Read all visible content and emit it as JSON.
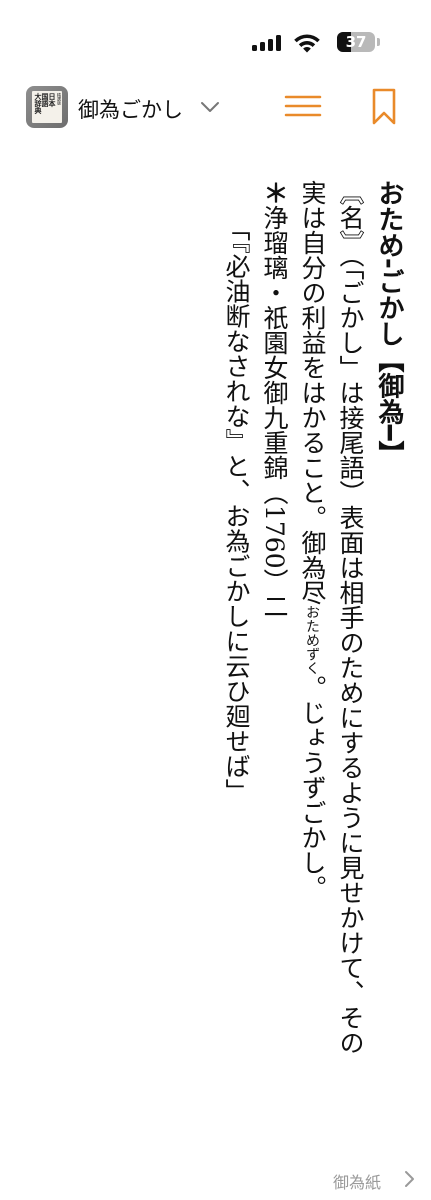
{
  "status_bar": {
    "battery": "37"
  },
  "header": {
    "app_icon_text": [
      "国語",
      "日本",
      "大辞典",
      "精選版"
    ],
    "title": "御為ごかし",
    "accent_color": "#e98a2a"
  },
  "entry": {
    "headword": "おため‐ごかし【御為━】",
    "definition_lead": "〘名〙（「ごかし」は接尾語）表面は相手のためにするように見せかけて、その実は自分の利益をはかること。",
    "definition_tail_1": "御為尽",
    "ruby": "おためずく",
    "definition_tail_2": "。じょうずごかし。",
    "quote_mark": "＊",
    "quote_source": "浄瑠璃・祇園女御九重錦（1760）二",
    "quote_text": "「『必油断なされな』と、お為ごかしに云ひ廻せば」"
  },
  "footer": {
    "next_label": "御為紙"
  },
  "icons": [
    "signal-icon",
    "wifi-icon",
    "battery-icon",
    "dictionary-app-icon",
    "chevron-down-icon",
    "menu-icon",
    "bookmark-icon",
    "chevron-right-icon"
  ]
}
